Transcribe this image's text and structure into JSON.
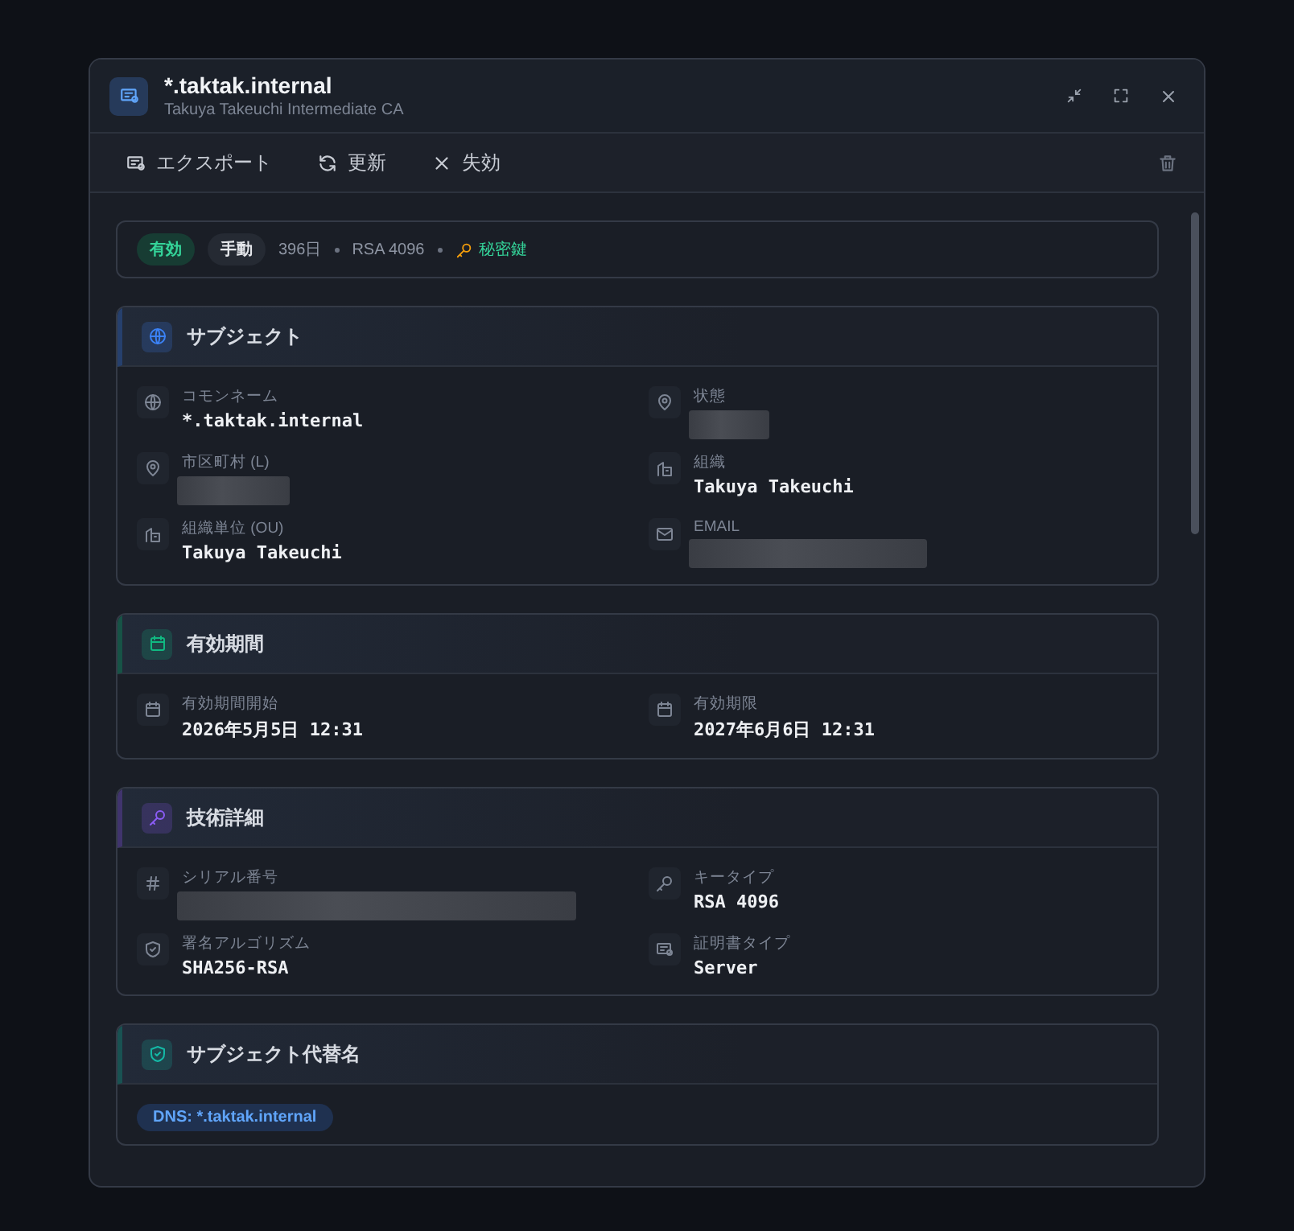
{
  "window": {
    "title": "*.taktak.internal",
    "subtitle": "Takuya Takeuchi Intermediate CA"
  },
  "toolbar": [
    {
      "label": "エクスポート",
      "kind": "export"
    },
    {
      "label": "更新",
      "kind": "renew"
    },
    {
      "label": "失効",
      "kind": "revoke"
    }
  ],
  "summary": {
    "status": "有効",
    "mode": "手動",
    "duration": "396日",
    "key": "RSA 4096",
    "private_key": "秘密鍵"
  },
  "sections": [
    {
      "title": "サブジェクト",
      "color": "#3b82f6",
      "kind": "subject",
      "fields": [
        {
          "label": "コモンネーム",
          "value": "*.taktak.internal"
        },
        {
          "label": "状態",
          "redacted": true
        },
        {
          "label": "市区町村 (L)",
          "redacted": true
        },
        {
          "label": "組織",
          "value": "Takuya Takeuchi"
        },
        {
          "label": "組織単位 (OU)",
          "value": "Takuya Takeuchi"
        },
        {
          "label": "EMAIL",
          "redacted": true
        }
      ]
    },
    {
      "title": "有効期間",
      "color": "#10b981",
      "kind": "validity",
      "fields": [
        {
          "label": "有効期間開始",
          "value": "2026年5月5日 12:31"
        },
        {
          "label": "有効期限",
          "value": "2027年6月6日 12:31"
        }
      ]
    },
    {
      "title": "技術詳細",
      "color": "#8b5cf6",
      "kind": "technical",
      "fields": [
        {
          "label": "シリアル番号",
          "redacted": true
        },
        {
          "label": "キータイプ",
          "value": "RSA 4096"
        },
        {
          "label": "署名アルゴリズム",
          "value": "SHA256-RSA"
        },
        {
          "label": "証明書タイプ",
          "value": "Server"
        }
      ]
    },
    {
      "title": "サブジェクト代替名",
      "color": "#14b8a6",
      "kind": "san",
      "chips": [
        {
          "type": "DNS:",
          "value": "*.taktak.internal"
        }
      ]
    }
  ]
}
